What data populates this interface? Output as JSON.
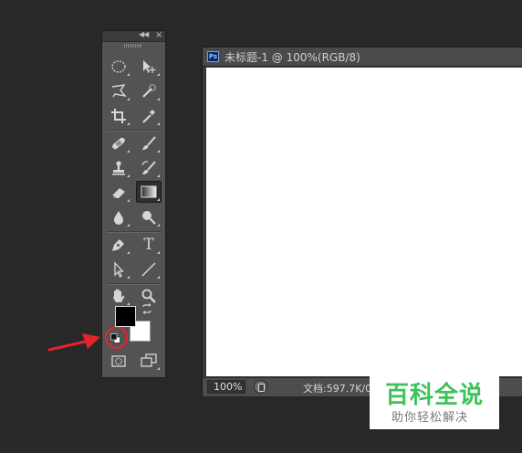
{
  "toolbox": {
    "collapse_icon": "double-chevron-left-icon",
    "close_label": "×",
    "tools": [
      {
        "name": "marquee-tool",
        "icon": "elliptical-marquee-icon"
      },
      {
        "name": "move-tool",
        "icon": "move-icon"
      },
      {
        "name": "lasso-tool",
        "icon": "polygonal-lasso-icon"
      },
      {
        "name": "quick-selection-tool",
        "icon": "quick-selection-icon"
      },
      {
        "name": "crop-tool",
        "icon": "crop-icon"
      },
      {
        "name": "eyedropper-tool",
        "icon": "eyedropper-icon"
      },
      {
        "name": "healing-brush-tool",
        "icon": "bandage-icon"
      },
      {
        "name": "brush-tool",
        "icon": "brush-icon"
      },
      {
        "name": "clone-stamp-tool",
        "icon": "stamp-icon"
      },
      {
        "name": "history-brush-tool",
        "icon": "history-brush-icon"
      },
      {
        "name": "eraser-tool",
        "icon": "eraser-icon"
      },
      {
        "name": "gradient-tool",
        "icon": "gradient-icon",
        "active": true
      },
      {
        "name": "blur-tool",
        "icon": "drop-icon"
      },
      {
        "name": "dodge-tool",
        "icon": "dodge-icon"
      },
      {
        "name": "pen-tool",
        "icon": "pen-icon"
      },
      {
        "name": "type-tool",
        "icon": "type-icon",
        "glyph": "T"
      },
      {
        "name": "path-selection-tool",
        "icon": "arrow-pointer-icon"
      },
      {
        "name": "line-tool",
        "icon": "line-icon"
      },
      {
        "name": "hand-tool",
        "icon": "hand-icon"
      },
      {
        "name": "zoom-tool",
        "icon": "zoom-icon"
      },
      {
        "name": "quick-mask-mode",
        "icon": "quick-mask-icon"
      },
      {
        "name": "screen-mode",
        "icon": "screen-mode-icon"
      }
    ],
    "foreground_color": "#000000",
    "background_color": "#ffffff"
  },
  "document": {
    "badge": "Ps",
    "title": "未标题-1 @ 100%(RGB/8)",
    "canvas_color": "#ffffff",
    "status": {
      "zoom": "100%",
      "info": "文档:597.7K/0"
    }
  },
  "annotation": {
    "arrow_color": "#e4242b",
    "circle_color": "#e4242b"
  },
  "watermark": {
    "title": "百科全说",
    "subtitle": "助你轻松解决",
    "color": "#3ec35a"
  }
}
